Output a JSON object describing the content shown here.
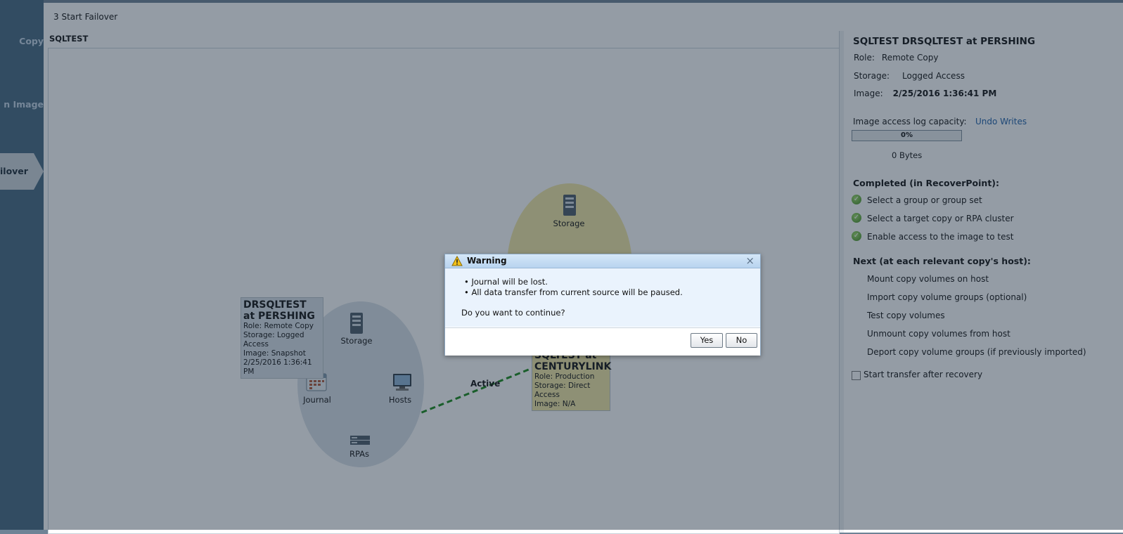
{
  "rail": {
    "items": [
      {
        "label": "Copy"
      },
      {
        "label": "n Image"
      },
      {
        "label": "ilover"
      }
    ]
  },
  "page": {
    "title": "3  Start Failover",
    "canvas_title": "SQLTEST"
  },
  "diagram": {
    "left_copy": {
      "title": "DRSQLTEST at PERSHING",
      "role": "Role: Remote Copy",
      "storage": "Storage: Logged Access",
      "image": "Image: Snapshot",
      "timestamp": "2/25/2016 1:36:41 PM",
      "nodes": {
        "storage": "Storage",
        "journal": "Journal",
        "hosts": "Hosts",
        "rpas": "RPAs"
      }
    },
    "right_copy": {
      "title": "SQLTEST at CENTURYLINK",
      "role": "Role: Production",
      "storage": "Storage: Direct Access",
      "image": "Image: N/A",
      "nodes": {
        "storage": "Storage"
      }
    },
    "link_label": "Active"
  },
  "details": {
    "title": "SQLTEST DRSQLTEST at PERSHING",
    "role_label": "Role:",
    "role_value": "Remote Copy",
    "storage_label": "Storage:",
    "storage_value": "Logged Access",
    "image_label": "Image:",
    "image_value": "2/25/2016 1:36:41 PM",
    "log_capacity_label": "Image access log capacity:",
    "undo_writes": "Undo Writes",
    "progress_text": "0%",
    "progress_fraction": 0,
    "bytes": "0 Bytes",
    "completed_heading": "Completed (in RecoverPoint):",
    "completed_steps": [
      "Select a group or group set",
      "Select a target copy or RPA cluster",
      "Enable access to the image to test"
    ],
    "next_heading": "Next (at each relevant copy's host):",
    "next_steps": [
      "Mount copy volumes on host",
      "Import copy volume groups (optional)",
      "Test copy volumes",
      "Unmount copy volumes from host",
      "Deport copy volume groups (if previously imported)"
    ],
    "transfer_label": "Start transfer after recovery"
  },
  "dialog": {
    "title": "Warning",
    "bullets": [
      "• Journal will be lost.",
      "• All data transfer from current source will be paused."
    ],
    "question": "Do you want to continue?",
    "yes": "Yes",
    "no": "No"
  },
  "colors": {
    "overlay": "#1c2d40",
    "rail": "#476880",
    "link": "#1d5fa8",
    "active_line": "#1a8a1a",
    "production_ellipse": "#f3e8a4",
    "copy_ellipse": "#d9e1e8"
  }
}
